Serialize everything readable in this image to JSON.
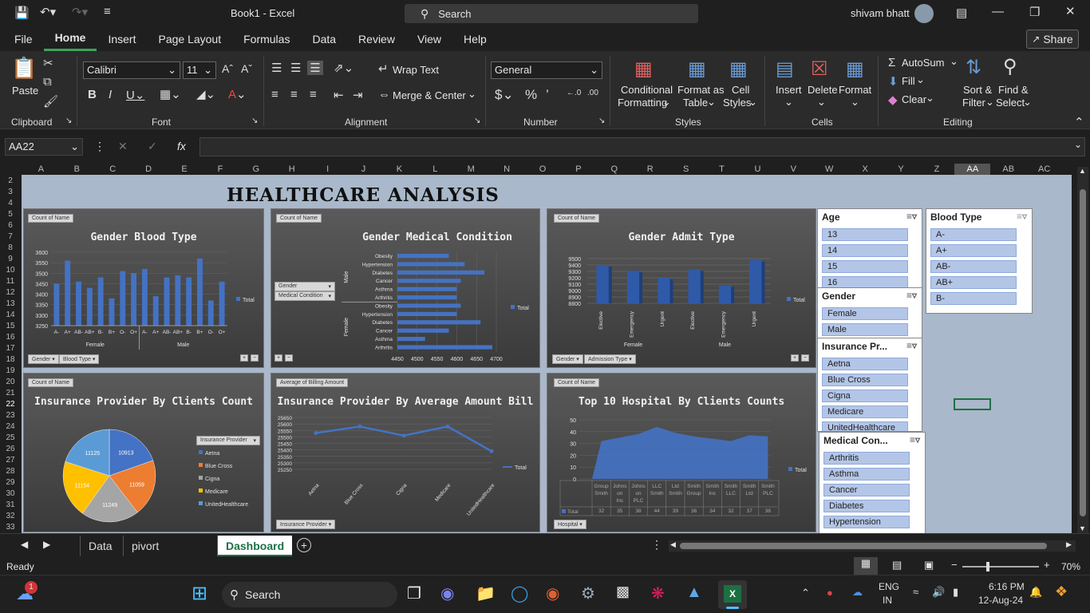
{
  "title_bar": {
    "doc_title": "Book1 - Excel",
    "search_label": "Search",
    "user": "shivam bhatt"
  },
  "menu": {
    "items": [
      "File",
      "Home",
      "Insert",
      "Page Layout",
      "Formulas",
      "Data",
      "Review",
      "View",
      "Help"
    ],
    "active": "Home",
    "share": "Share"
  },
  "ribbon": {
    "clipboard": {
      "paste": "Paste",
      "label": "Clipboard"
    },
    "font": {
      "name": "Calibri",
      "size": "11",
      "label": "Font"
    },
    "alignment": {
      "wrap": "Wrap Text",
      "merge": "Merge & Center",
      "label": "Alignment"
    },
    "number": {
      "format": "General",
      "label": "Number"
    },
    "styles": {
      "cond_1": "Conditional",
      "cond_2": "Formatting",
      "format_1": "Format as",
      "format_2": "Table",
      "cell_1": "Cell",
      "cell_2": "Styles",
      "label": "Styles"
    },
    "cells": {
      "insert": "Insert",
      "delete": "Delete",
      "format": "Format",
      "label": "Cells"
    },
    "editing": {
      "autosum": "AutoSum",
      "fill": "Fill",
      "clear": "Clear",
      "sort_1": "Sort &",
      "sort_2": "Filter",
      "find_1": "Find &",
      "find_2": "Select",
      "label": "Editing"
    }
  },
  "formula_bar": {
    "name_box": "AA22",
    "fx": "fx",
    "formula": ""
  },
  "columns": [
    "A",
    "B",
    "C",
    "D",
    "E",
    "F",
    "G",
    "H",
    "I",
    "J",
    "K",
    "L",
    "M",
    "N",
    "O",
    "P",
    "Q",
    "R",
    "S",
    "T",
    "U",
    "V",
    "W",
    "X",
    "Y",
    "Z",
    "AA",
    "AB",
    "AC"
  ],
  "rows": [
    "2",
    "3",
    "4",
    "5",
    "6",
    "7",
    "8",
    "9",
    "10",
    "11",
    "12",
    "13",
    "14",
    "15",
    "16",
    "17",
    "18",
    "19",
    "20",
    "21",
    "22",
    "23",
    "24",
    "25",
    "26",
    "27",
    "28",
    "29",
    "30",
    "31",
    "32",
    "33"
  ],
  "dashboard": {
    "title": "HEALTHCARE ANALYSIS",
    "charts": {
      "c1": {
        "title": "Gender Blood Type",
        "tag": "Count of Name",
        "filter1": "Gender",
        "filter2": "Blood Type",
        "legend": "Total"
      },
      "c2": {
        "title": "Gender Medical Condition",
        "tag": "Count of Name",
        "filter1": "Gender",
        "filter2": "Medical Condition",
        "legend": "Total"
      },
      "c3": {
        "title": "Gender Admit Type",
        "tag": "Count of Name",
        "filter1": "Gender",
        "filter2": "Admission Type",
        "legend": "Total"
      },
      "c4": {
        "title": "Insurance Provider By Clients Count",
        "tag": "Count of Name",
        "filter1": "Insurance Provider"
      },
      "c5": {
        "title": "Insurance Provider By Average Amount Bill",
        "tag": "Average of Billing Amount",
        "filter1": "Insurance Provider",
        "legend": "Total"
      },
      "c6": {
        "title": "Top 10 Hospital By Clients Counts",
        "tag": "Count of Name",
        "filter1": "Hospital",
        "legend": "Total",
        "table_label": "Total"
      }
    }
  },
  "slicers": {
    "age": {
      "title": "Age",
      "items": [
        "13",
        "14",
        "15",
        "16"
      ]
    },
    "blood": {
      "title": "Blood Type",
      "items": [
        "A-",
        "A+",
        "AB-",
        "AB+",
        "B-"
      ]
    },
    "gender": {
      "title": "Gender",
      "items": [
        "Female",
        "Male"
      ]
    },
    "insurance": {
      "title": "Insurance Pr...",
      "items": [
        "Aetna",
        "Blue Cross",
        "Cigna",
        "Medicare",
        "UnitedHealthcare"
      ]
    },
    "medical": {
      "title": "Medical Con...",
      "items": [
        "Arthritis",
        "Asthma",
        "Cancer",
        "Diabetes",
        "Hypertension"
      ]
    }
  },
  "sheet_tabs": [
    "Data",
    "pivort table",
    "Dashboard"
  ],
  "active_tab": "Dashboard",
  "status": {
    "ready": "Ready",
    "zoom": "70%"
  },
  "taskbar": {
    "search": "Search",
    "lang1": "ENG",
    "lang2": "IN",
    "time": "6:16 PM",
    "date": "12-Aug-24",
    "notif": "1"
  },
  "chart_data": [
    {
      "type": "bar",
      "title": "Gender Blood Type",
      "groups": [
        "Female",
        "Male"
      ],
      "categories": [
        "A-",
        "A+",
        "AB-",
        "AB+",
        "B-",
        "B+",
        "O-",
        "O+"
      ],
      "series": [
        {
          "name": "Total",
          "values": [
            3450,
            3560,
            3460,
            3430,
            3480,
            3380,
            3510,
            3500,
            3520,
            3390,
            3480,
            3490,
            3480,
            3570,
            3370,
            3460
          ]
        }
      ],
      "ylim": [
        3250,
        3600
      ],
      "yticks": [
        3250,
        3300,
        3350,
        3400,
        3450,
        3500,
        3550,
        3600
      ]
    },
    {
      "type": "bar",
      "orientation": "horizontal",
      "title": "Gender Medical Condition",
      "groups": [
        "Male",
        "Female"
      ],
      "categories": [
        "Obesity",
        "Hypertension",
        "Diabetes",
        "Cancer",
        "Asthma",
        "Arthritis"
      ],
      "series": [
        {
          "name": "Total",
          "values": [
            4580,
            4620,
            4670,
            4610,
            4600,
            4600,
            4610,
            4600,
            4660,
            4580,
            4520,
            4690
          ]
        }
      ],
      "xlim": [
        4450,
        4700
      ],
      "xticks": [
        4450,
        4500,
        4550,
        4600,
        4650,
        4700
      ]
    },
    {
      "type": "bar",
      "title": "Gender Admit Type",
      "groups": [
        "Female",
        "Male"
      ],
      "categories": [
        "Elective",
        "Emergency",
        "Urgent",
        "Elective",
        "Emergency",
        "Urgent"
      ],
      "series": [
        {
          "name": "Total",
          "values": [
            9400,
            9310,
            9200,
            9330,
            9080,
            9480
          ]
        }
      ],
      "ylim": [
        8800,
        9500
      ],
      "yticks": [
        8800,
        8900,
        9000,
        9100,
        9200,
        9300,
        9400,
        9500
      ]
    },
    {
      "type": "pie",
      "title": "Insurance Provider By Clients Count",
      "categories": [
        "Aetna",
        "Blue Cross",
        "Cigna",
        "Medicare",
        "UnitedHealthcare"
      ],
      "values": [
        10913,
        11059,
        11249,
        11154,
        11125
      ],
      "colors": [
        "#4472c4",
        "#ed7d31",
        "#a5a5a5",
        "#ffc000",
        "#5b9bd5"
      ]
    },
    {
      "type": "line",
      "title": "Insurance Provider By Average Amount Bill",
      "categories": [
        "Aetna",
        "Blue Cross",
        "Cigna",
        "Medicare",
        "UnitedHealthcare"
      ],
      "series": [
        {
          "name": "Total",
          "values": [
            25530,
            25580,
            25510,
            25580,
            25390
          ]
        }
      ],
      "ylim": [
        25250,
        25650
      ],
      "yticks": [
        25250,
        25300,
        25350,
        25400,
        25450,
        25500,
        25550,
        25600,
        25650
      ]
    },
    {
      "type": "area",
      "title": "Top 10 Hospital By Clients Counts",
      "categories": [
        "Group Smith",
        "Johns on Inc",
        "Johns on PLC",
        "LLC Smith",
        "Ltd Smith",
        "Smith Group",
        "Smith Inc",
        "Smith LLC",
        "Smith Ltd",
        "Smith PLC"
      ],
      "series": [
        {
          "name": "Total",
          "values": [
            32,
            35,
            38,
            44,
            39,
            36,
            34,
            32,
            37,
            36
          ]
        }
      ],
      "ylim": [
        0,
        50
      ],
      "yticks": [
        0,
        10,
        20,
        30,
        40,
        50
      ]
    }
  ]
}
